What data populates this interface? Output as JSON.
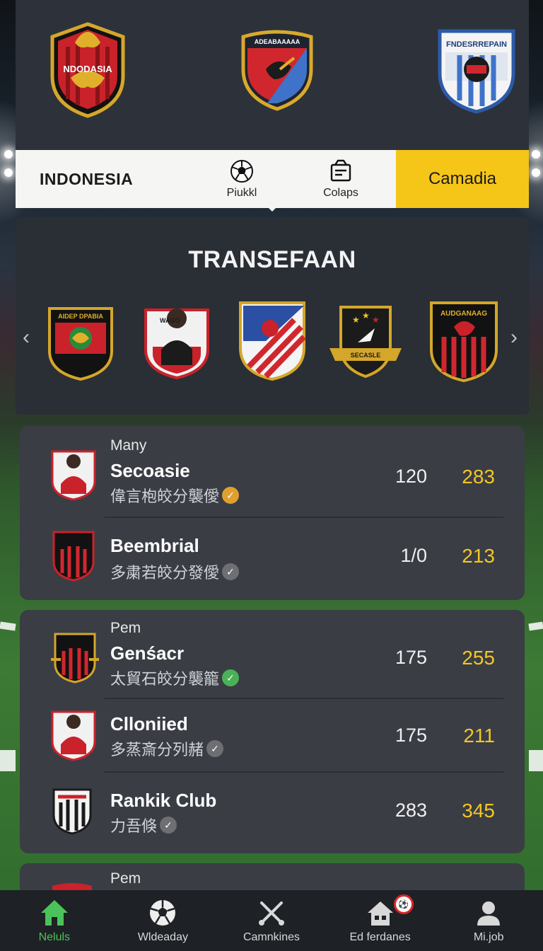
{
  "top_teams": {
    "crest_left_text": "NDODASIA",
    "crest_center_text": "ADEABAAAAA",
    "crest_right_text": "FNDESRREPAIN"
  },
  "team_bar": {
    "home_team": "INDONESIA",
    "tool_one_label": "Piukkl",
    "tool_two_label": "Colaps",
    "away_team": "Camadia"
  },
  "carousel": {
    "title": "TRANSEFAAN",
    "crests": [
      {
        "text": "AIDEP DPABIA"
      },
      {
        "text": "WAGO"
      },
      {
        "text": ""
      },
      {
        "text": "SECASLE"
      },
      {
        "text": "AUDGANAAG"
      }
    ]
  },
  "groups": [
    {
      "rows": [
        {
          "tag": "Many",
          "name": "Secoasie",
          "sub": "偉言枹皎分襲僾",
          "value1": "120",
          "value2": "283",
          "mark_color": "#e0a030"
        },
        {
          "tag": "",
          "name": "Beembrial",
          "sub": "多粛若皎分發僾",
          "value1": "1/0",
          "value2": "213",
          "mark_color": "#6d6f73"
        }
      ]
    },
    {
      "rows": [
        {
          "tag": "Pem",
          "name": "Genśacr",
          "sub": "太貿石皎分襲籠",
          "value1": "175",
          "value2": "255",
          "mark_color": "#4bb157"
        },
        {
          "tag": "",
          "name": "Clloniied",
          "sub": "多蒸斎分列赭",
          "value1": "175",
          "value2": "211",
          "mark_color": "#6d6f73"
        },
        {
          "tag": "",
          "name": "Rankik Club",
          "sub": "力吾倏",
          "value1": "283",
          "value2": "345",
          "mark_color": "#6d6f73"
        }
      ]
    },
    {
      "rows": [
        {
          "tag": "Pem"
        }
      ]
    }
  ],
  "bottom_nav": [
    {
      "label": "Neluls",
      "icon": "home-icon",
      "active": true
    },
    {
      "label": "Wldeaday",
      "icon": "soccer-ball-icon"
    },
    {
      "label": "Camnkines",
      "icon": "crossed-tools-icon"
    },
    {
      "label": "Ed ferdanes",
      "icon": "stadium-icon"
    },
    {
      "label": "Mi.job",
      "icon": "profile-icon"
    }
  ],
  "colors": {
    "accent_yellow": "#f5c518",
    "value_yellow": "#f3c626",
    "active_green": "#4cc35a",
    "card_bg": "#3a3d44",
    "panel_bg": "#2c3038"
  }
}
